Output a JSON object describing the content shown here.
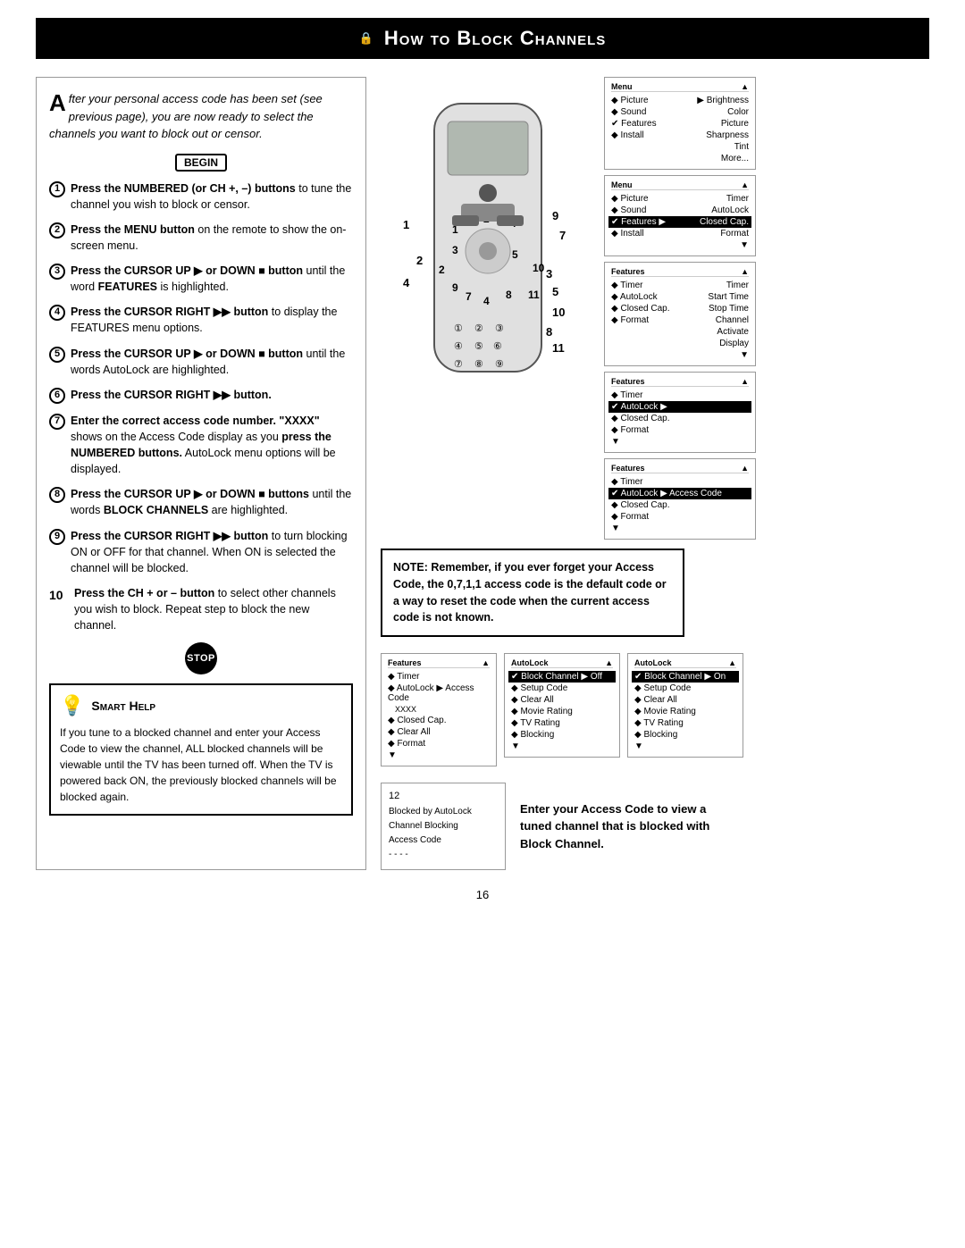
{
  "page": {
    "title": "How to Block Channels",
    "page_number": "16"
  },
  "header": {
    "title": "How to Block Channels",
    "lock_icon": "🔒"
  },
  "intro": {
    "drop_cap": "A",
    "text": "fter your personal access code has been set (see previous page), you are now ready to select the channels you want to block out or censor."
  },
  "begin_label": "BEGIN",
  "steps": [
    {
      "num": "1",
      "text_parts": [
        {
          "bold": true,
          "text": "Press the NUMBERED (or CH +, –) buttons"
        },
        {
          "bold": false,
          "text": " to tune the channel you wish to block or censor."
        }
      ]
    },
    {
      "num": "2",
      "text_parts": [
        {
          "bold": true,
          "text": "Press the MENU button"
        },
        {
          "bold": false,
          "text": " on the remote to show the on-screen menu."
        }
      ]
    },
    {
      "num": "3",
      "text_parts": [
        {
          "bold": true,
          "text": "Press the CURSOR UP"
        },
        {
          "bold": false,
          "text": " ▶ or "
        },
        {
          "bold": true,
          "text": "DOWN ■ button"
        },
        {
          "bold": false,
          "text": " until the word "
        },
        {
          "bold": true,
          "text": "FEATURES"
        },
        {
          "bold": false,
          "text": " is highlighted."
        }
      ]
    },
    {
      "num": "4",
      "text_parts": [
        {
          "bold": true,
          "text": "Press the CURSOR RIGHT ▶▶ button"
        },
        {
          "bold": false,
          "text": " to display the FEATURES menu options."
        }
      ]
    },
    {
      "num": "5",
      "text_parts": [
        {
          "bold": true,
          "text": "Press the CURSOR UP"
        },
        {
          "bold": false,
          "text": " ▶ or "
        },
        {
          "bold": true,
          "text": "DOWN ■ button"
        },
        {
          "bold": false,
          "text": " until the words AutoLock are highlighted."
        }
      ]
    },
    {
      "num": "6",
      "text_parts": [
        {
          "bold": true,
          "text": "Press the CURSOR RIGHT ▶▶ button."
        }
      ]
    },
    {
      "num": "7",
      "text_parts": [
        {
          "bold": true,
          "text": "Enter the correct access code number. \"XXXX\""
        },
        {
          "bold": false,
          "text": " shows on the Access Code display as you "
        },
        {
          "bold": true,
          "text": "press the NUMBERED buttons."
        },
        {
          "bold": false,
          "text": " AutoLock menu options will be displayed."
        }
      ]
    },
    {
      "num": "8",
      "text_parts": [
        {
          "bold": true,
          "text": "Press the CURSOR UP"
        },
        {
          "bold": false,
          "text": " ▶ or "
        },
        {
          "bold": true,
          "text": "DOWN ■ buttons"
        },
        {
          "bold": false,
          "text": " until the words "
        },
        {
          "bold": true,
          "text": "BLOCK CHANNELS"
        },
        {
          "bold": false,
          "text": " are highlighted."
        }
      ]
    },
    {
      "num": "9",
      "text_parts": [
        {
          "bold": true,
          "text": "Press the CURSOR RIGHT ▶▶ button"
        },
        {
          "bold": false,
          "text": " to turn blocking ON or OFF for that channel. When ON is selected the channel will be blocked."
        }
      ]
    },
    {
      "num": "10",
      "text_parts": [
        {
          "bold": true,
          "text": "Press the CH + or – button"
        },
        {
          "bold": false,
          "text": " to select other channels you wish to block. Repeat step to block the new channel."
        }
      ]
    }
  ],
  "stop_label": "STOP",
  "smart_help": {
    "title": "Smart Help",
    "text": "If you tune to a blocked channel and enter your Access Code to view the channel, ALL blocked channels will be viewable until the TV has been turned off. When the TV is powered back ON, the previously blocked channels will be blocked again."
  },
  "note_box": {
    "text": "NOTE: Remember, if you ever forget your Access Code, the 0,7,1,1 access code is the default code or a way to reset the code when the current access code is not known."
  },
  "enter_code_text": "Enter your Access Code to view a tuned channel that is blocked with Block Channel.",
  "menu_screens": {
    "screen1": {
      "title": "Menu",
      "rows": [
        {
          "label": "Picture",
          "value": "Brightness",
          "arrow": true
        },
        {
          "label": "Sound",
          "value": "Color"
        },
        {
          "label": "Features",
          "value": "Picture"
        },
        {
          "label": "Install",
          "value": "Sharpness"
        },
        {
          "label": "",
          "value": "Tint"
        },
        {
          "label": "",
          "value": "More..."
        }
      ]
    },
    "screen2": {
      "title": "Menu",
      "rows": [
        {
          "label": "Picture",
          "value": "Timer"
        },
        {
          "label": "Sound",
          "value": "AutoLock"
        },
        {
          "label": "Features",
          "value": "Closed Cap.",
          "highlighted": true,
          "arrow": true
        },
        {
          "label": "Install",
          "value": "Format"
        }
      ]
    },
    "screen3": {
      "title": "Features",
      "rows": [
        {
          "label": "Timer",
          "value": "Timer"
        },
        {
          "label": "AutoLock",
          "value": "Start Time"
        },
        {
          "label": "Closed Cap.",
          "value": "Stop Time"
        },
        {
          "label": "Format",
          "value": "Channel"
        },
        {
          "label": "",
          "value": "Activate"
        },
        {
          "label": "",
          "value": "Display"
        }
      ]
    },
    "screen4": {
      "title": "Features",
      "rows": [
        {
          "label": "Timer"
        },
        {
          "label": "AutoLock",
          "highlighted": true,
          "arrow": true
        },
        {
          "label": "Closed Cap."
        },
        {
          "label": "Format"
        }
      ]
    },
    "screen5": {
      "title": "Features",
      "rows": [
        {
          "label": "Timer"
        },
        {
          "label": "AutoLock",
          "value": "Access Code",
          "highlighted": true,
          "arrow": true
        },
        {
          "label": "Closed Cap."
        },
        {
          "label": "Format"
        }
      ]
    }
  },
  "bottom_screens": {
    "screen_features": {
      "title": "Features",
      "rows": [
        {
          "label": "Timer"
        },
        {
          "label": "AutoLock",
          "value": "Access Code",
          "arrow": true
        },
        {
          "label": "Closed Cap."
        },
        {
          "label": "Clear All"
        },
        {
          "label": "Format"
        }
      ],
      "access_code": "XXXX"
    },
    "screen_autolock_off": {
      "title": "AutoLock",
      "rows": [
        {
          "label": "Block Channel",
          "value": "Off",
          "arrow": true,
          "highlighted": true
        },
        {
          "label": "Setup Code"
        },
        {
          "label": "Clear All"
        },
        {
          "label": "Movie Rating"
        },
        {
          "label": "TV Rating"
        },
        {
          "label": "Blocking"
        }
      ]
    },
    "screen_autolock_on": {
      "title": "AutoLock",
      "rows": [
        {
          "label": "Block Channel",
          "value": "On",
          "arrow": true,
          "highlighted": true
        },
        {
          "label": "Setup Code"
        },
        {
          "label": "Clear All"
        },
        {
          "label": "Movie Rating"
        },
        {
          "label": "TV Rating"
        },
        {
          "label": "Blocking"
        }
      ]
    }
  },
  "channel_blocked": {
    "channel_num": "12",
    "lines": [
      "Blocked by AutoLock",
      "Channel Blocking",
      "Access Code",
      "- - - -"
    ]
  }
}
